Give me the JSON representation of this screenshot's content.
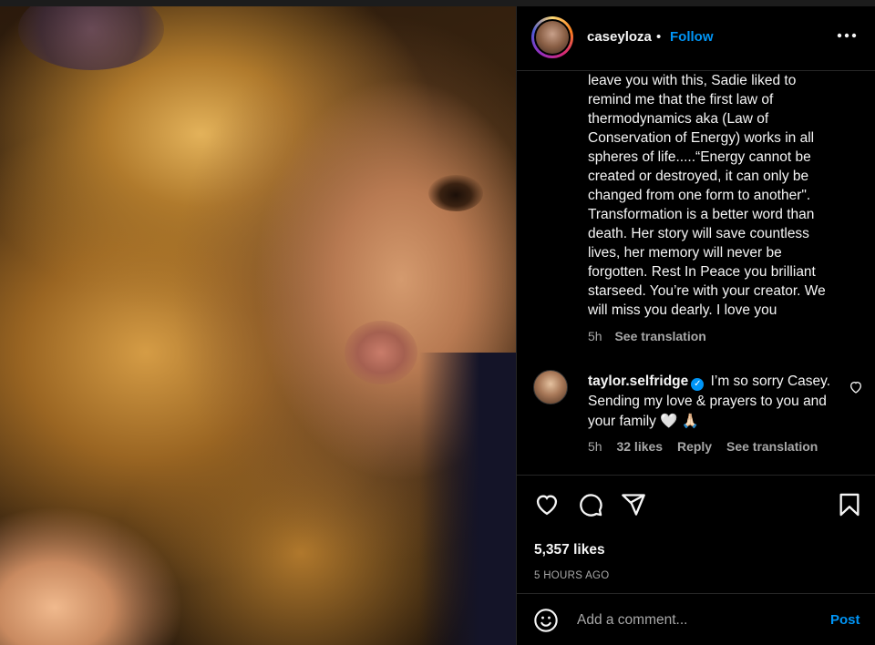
{
  "post": {
    "username": "caseyloza",
    "separator": "•",
    "follow_label": "Follow",
    "more_label": "•••",
    "caption": "leave you with this, Sadie liked to\nremind me that the first law of\nthermodynamics aka (Law of\nConservation of Energy) works in all\nspheres of life.....“Energy cannot be\ncreated or destroyed, it can only be\nchanged from one form to another\".\nTransformation is a better word than\ndeath. Her story will save countless\nlives, her memory will never be\nforgotten. Rest In Peace you brilliant\nstarseed. You’re with your creator. We\nwill miss you dearly. I love you",
    "caption_time": "5h",
    "see_translation": "See translation",
    "likes": "5,357 likes",
    "posted_ago": "5 HOURS AGO"
  },
  "comment": {
    "username": "taylor.selfridge",
    "verified_mark": "✓",
    "text": "I’m so sorry Casey. Sending my love & prayers to you and your family 🤍 🙏🏻",
    "time": "5h",
    "likes": "32 likes",
    "reply": "Reply",
    "see_translation": "See translation"
  },
  "composer": {
    "placeholder": "Add a comment...",
    "post_label": "Post"
  },
  "colors": {
    "accent": "#0095f6",
    "background": "#000000",
    "muted": "#a8a8a8"
  },
  "icons": [
    "more-options-icon",
    "verified-icon",
    "heart-icon",
    "comment-icon",
    "share-icon",
    "bookmark-icon",
    "emoji-icon"
  ]
}
